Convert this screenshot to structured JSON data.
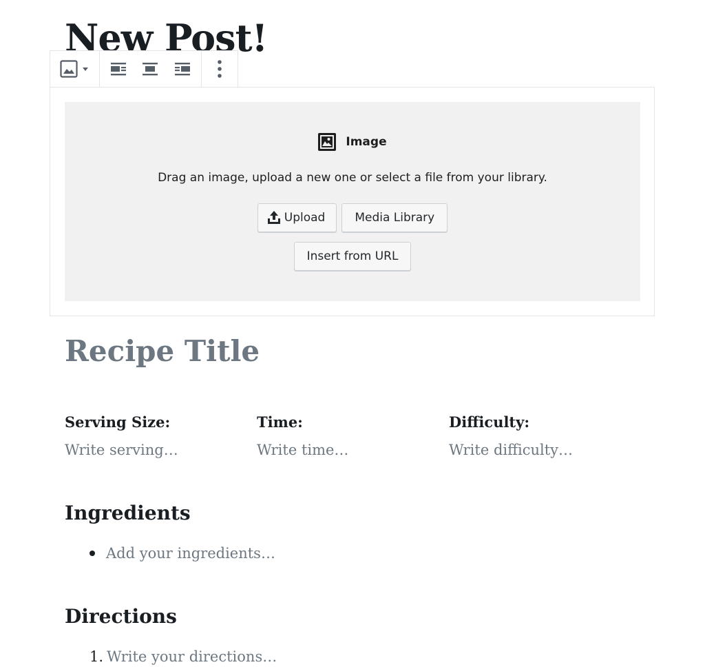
{
  "post": {
    "title": "New Post!"
  },
  "toolbar": {
    "icons": [
      "image-icon",
      "dropdown-caret-icon",
      "align-left-icon",
      "align-center-icon",
      "align-right-icon",
      "more-options-icon"
    ]
  },
  "image_block": {
    "label": "Image",
    "instructions": "Drag an image, upload a new one or select a file from your library.",
    "upload_label": "Upload",
    "media_library_label": "Media Library",
    "insert_url_label": "Insert from URL"
  },
  "recipe": {
    "title_placeholder": "Recipe Title",
    "serving": {
      "heading": "Serving Size:",
      "placeholder": "Write serving…"
    },
    "time": {
      "heading": "Time:",
      "placeholder": "Write time…"
    },
    "difficulty": {
      "heading": "Difficulty:",
      "placeholder": "Write difficulty…"
    },
    "ingredients": {
      "heading": "Ingredients",
      "placeholder": "Add your ingredients…"
    },
    "directions": {
      "heading": "Directions",
      "number": "1.",
      "placeholder": "Write your directions…"
    }
  },
  "colors": {
    "text": "#191e23",
    "placeholder": "#6c7781",
    "border": "#e2e4e7",
    "placeholder_bg": "#f1f1f1"
  }
}
